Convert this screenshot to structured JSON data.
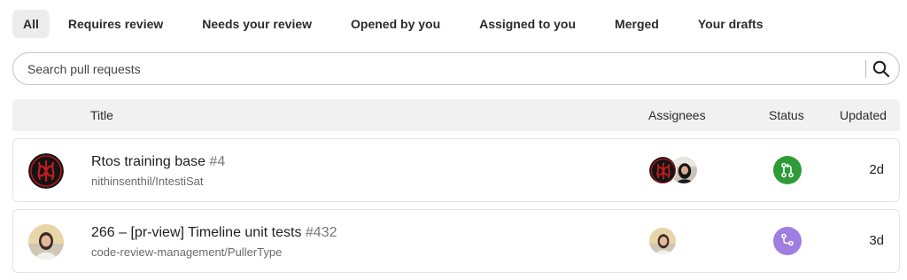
{
  "tabs": [
    {
      "label": "All",
      "active": true
    },
    {
      "label": "Requires review",
      "active": false
    },
    {
      "label": "Needs your review",
      "active": false
    },
    {
      "label": "Opened by you",
      "active": false
    },
    {
      "label": "Assigned to you",
      "active": false
    },
    {
      "label": "Merged",
      "active": false
    },
    {
      "label": "Your drafts",
      "active": false
    }
  ],
  "search": {
    "placeholder": "Search pull requests",
    "value": "",
    "icon": "search-icon"
  },
  "table": {
    "headers": {
      "title": "Title",
      "assignees": "Assignees",
      "status": "Status",
      "updated": "Updated"
    },
    "rows": [
      {
        "title": "Rtos training base",
        "number": "#4",
        "repo": "nithinsenthil/IntestiSat",
        "author_avatar": "emblem-avatar",
        "assignees": [
          "emblem-avatar",
          "photo-avatar"
        ],
        "status_icon": "pull-request-open-icon",
        "status_color": "#2e9b38",
        "updated": "2d"
      },
      {
        "title": "266 – [pr-view] Timeline unit tests",
        "number": "#432",
        "repo": "code-review-management/PullerType",
        "author_avatar": "photo-avatar",
        "assignees": [
          "photo-avatar"
        ],
        "status_icon": "pull-request-draft-icon",
        "status_color": "#a07de0",
        "updated": "3d"
      }
    ]
  }
}
